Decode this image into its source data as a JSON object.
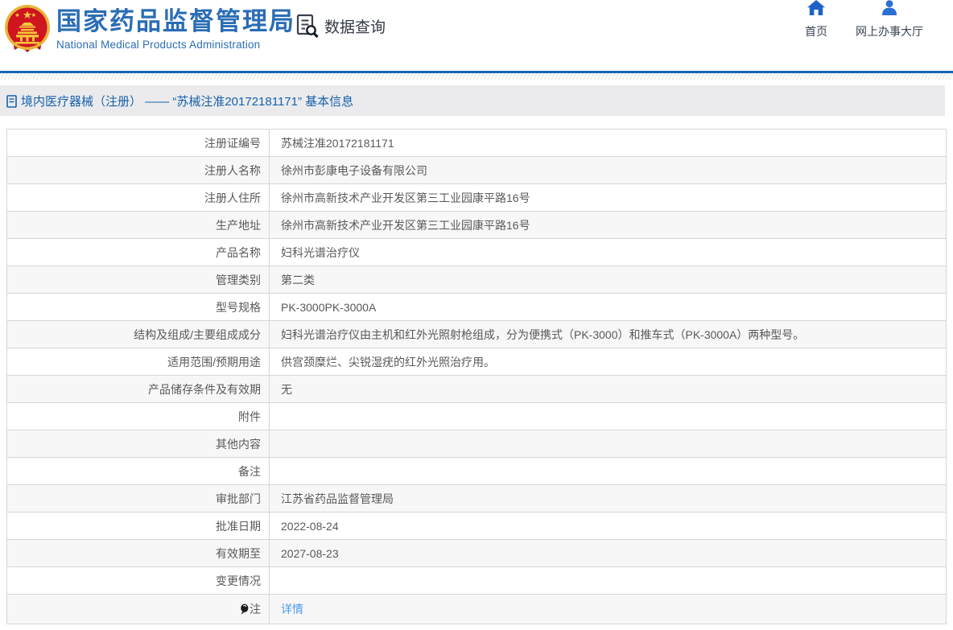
{
  "header": {
    "logo_icon": "national-emblem-logo",
    "title_cn": "国家药品监督管理局",
    "title_en": "National Medical Products Administration",
    "data_query": {
      "icon": "document-search-icon",
      "label": "数据查询"
    },
    "nav": [
      {
        "icon": "home-icon",
        "label": "首页"
      },
      {
        "icon": "person-icon",
        "label": "网上办事大厅"
      }
    ]
  },
  "breadcrumb": {
    "icon": "document-icon",
    "text": "境内医疗器械（注册） —— “苏械注准20172181171” 基本信息"
  },
  "table": {
    "rows": [
      {
        "label": "注册证编号",
        "value": "苏械注准20172181171"
      },
      {
        "label": "注册人名称",
        "value": "徐州市彭康电子设备有限公司"
      },
      {
        "label": "注册人住所",
        "value": "徐州市高新技术产业开发区第三工业园康平路16号"
      },
      {
        "label": "生产地址",
        "value": "徐州市高新技术产业开发区第三工业园康平路16号"
      },
      {
        "label": "产品名称",
        "value": "妇科光谱治疗仪"
      },
      {
        "label": "管理类别",
        "value": "第二类"
      },
      {
        "label": "型号规格",
        "value": "PK-3000PK-3000A"
      },
      {
        "label": "结构及组成/主要组成成分",
        "value": "妇科光谱治疗仪由主机和红外光照射枪组成，分为便携式（PK-3000）和推车式（PK-3000A）两种型号。"
      },
      {
        "label": "适用范围/预期用途",
        "value": "供宫颈糜烂、尖锐湿疣的红外光照治疗用。"
      },
      {
        "label": "产品储存条件及有效期",
        "value": "无"
      },
      {
        "label": "附件",
        "value": ""
      },
      {
        "label": "其他内容",
        "value": ""
      },
      {
        "label": "备注",
        "value": ""
      },
      {
        "label": "审批部门",
        "value": "江苏省药品监督管理局"
      },
      {
        "label": "批准日期",
        "value": "2022-08-24"
      },
      {
        "label": "有效期至",
        "value": "2027-08-23"
      },
      {
        "label": "变更情况",
        "value": ""
      },
      {
        "label": "注",
        "label_icon": "bulb-icon",
        "value": "详情",
        "value_type": "link"
      }
    ]
  },
  "colors": {
    "brand_blue": "#2a6db5",
    "header_line_blue": "#1b62b1",
    "breadcrumb_bg": "#ebebed",
    "breadcrumb_text": "#1661ab",
    "nav_icon_blue": "#1f63c8",
    "link_blue": "#4a9be8",
    "row_alt_bg": "#f7f7f8",
    "table_border": "#cccccc",
    "body_text": "#595959",
    "emblem_red": "#cf1520",
    "emblem_gold": "#e8b53a"
  }
}
